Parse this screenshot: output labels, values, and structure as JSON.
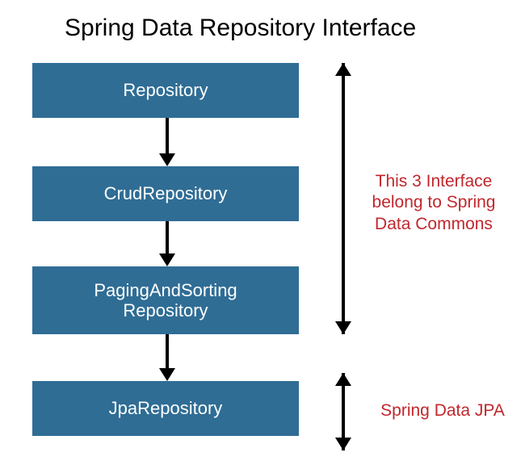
{
  "title": "Spring Data Repository Interface",
  "boxes": [
    "Repository",
    "CrudRepository",
    "PagingAndSorting\nRepository",
    "JpaRepository"
  ],
  "annotations": [
    "This 3 Interface belong to Spring Data Commons",
    "Spring Data JPA"
  ]
}
